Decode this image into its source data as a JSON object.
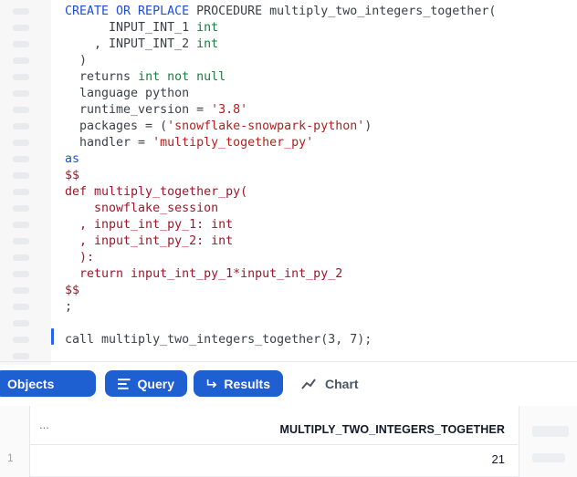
{
  "editor": {
    "lines": [
      [
        {
          "t": "CREATE OR REPLACE ",
          "c": "kw"
        },
        {
          "t": "PROCEDURE multiply_two_integers_together(",
          "c": ""
        }
      ],
      [
        {
          "t": "      INPUT_INT_1 ",
          "c": ""
        },
        {
          "t": "int",
          "c": "ty"
        }
      ],
      [
        {
          "t": "    , INPUT_INT_2 ",
          "c": ""
        },
        {
          "t": "int",
          "c": "ty"
        }
      ],
      [
        {
          "t": "  )",
          "c": ""
        }
      ],
      [
        {
          "t": "  returns ",
          "c": ""
        },
        {
          "t": "int not null",
          "c": "ty"
        }
      ],
      [
        {
          "t": "  language python",
          "c": ""
        }
      ],
      [
        {
          "t": "  runtime_version = ",
          "c": ""
        },
        {
          "t": "'3.8'",
          "c": "st"
        }
      ],
      [
        {
          "t": "  packages = (",
          "c": ""
        },
        {
          "t": "'snowflake-snowpark-python'",
          "c": "st"
        },
        {
          "t": ")",
          "c": ""
        }
      ],
      [
        {
          "t": "  handler = ",
          "c": ""
        },
        {
          "t": "'multiply_together_py'",
          "c": "st"
        }
      ],
      [
        {
          "t": "as",
          "c": "kw"
        }
      ],
      [
        {
          "t": "$$",
          "c": "py"
        }
      ],
      [
        {
          "t": "def multiply_together_py(",
          "c": "py"
        }
      ],
      [
        {
          "t": "    snowflake_session",
          "c": "py"
        }
      ],
      [
        {
          "t": "  , input_int_py_1: int",
          "c": "py"
        }
      ],
      [
        {
          "t": "  , input_int_py_2: int",
          "c": "py"
        }
      ],
      [
        {
          "t": "  ):",
          "c": "py"
        }
      ],
      [
        {
          "t": "  return input_int_py_1*input_int_py_2",
          "c": "py"
        }
      ],
      [
        {
          "t": "$$",
          "c": "py"
        }
      ],
      [
        {
          "t": ";",
          "c": ""
        }
      ],
      [
        {
          "t": "",
          "c": ""
        }
      ],
      [
        {
          "t": "call multiply_two_integers_together(3, 7);",
          "c": ""
        }
      ]
    ]
  },
  "tabs": {
    "objects": "Objects",
    "query": "Query",
    "results": "Results",
    "chart": "Chart"
  },
  "results": {
    "menu_label": "...",
    "column_header": "MULTIPLY_TWO_INTEGERS_TOGETHER",
    "rows": [
      {
        "num": "1",
        "value": "21"
      }
    ]
  },
  "colors": {
    "accent": "#1e5fd1",
    "keyword": "#1d4ed8",
    "type": "#15803d",
    "string": "#b91c1c",
    "python": "#a3142a"
  }
}
